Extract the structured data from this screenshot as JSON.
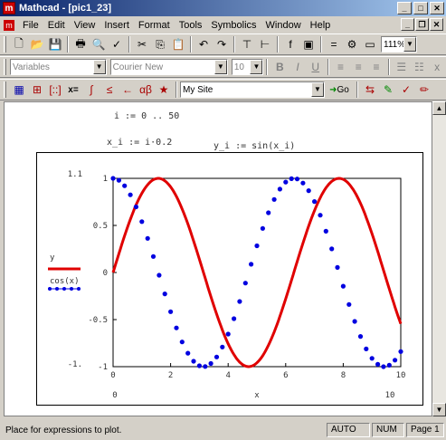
{
  "window": {
    "app_name": "Mathcad",
    "doc_title": "Mathcad - [pic1_23]"
  },
  "menu": [
    "File",
    "Edit",
    "View",
    "Insert",
    "Format",
    "Tools",
    "Symbolics",
    "Window",
    "Help"
  ],
  "toolbar": {
    "zoom": "111%"
  },
  "format_bar": {
    "style": "Variables",
    "font": "Courier New",
    "size": "10"
  },
  "math_bar": {
    "resource": "My Site",
    "go_label": "Go"
  },
  "worksheet": {
    "expr_range": "i := 0 .. 50",
    "expr_x": "x_i := i·0.2",
    "expr_y": "y_i := sin(x_i)"
  },
  "chart_data": {
    "type": "line",
    "x": [
      0,
      0.5,
      1,
      1.5,
      2,
      2.5,
      3,
      3.5,
      4,
      4.5,
      5,
      5.5,
      6,
      6.5,
      7,
      7.5,
      8,
      8.5,
      9,
      9.5,
      10
    ],
    "series": [
      {
        "name": "y",
        "style": "line",
        "color": "#e00000"
      },
      {
        "name": "cos(x)",
        "style": "dots",
        "color": "#0000e0"
      }
    ],
    "xlim": [
      0,
      10
    ],
    "ylim": [
      -1,
      1
    ],
    "xlabel": "x",
    "x_ticks": [
      "0",
      "2",
      "4",
      "6",
      "8",
      "10"
    ],
    "y_ticks": [
      "1",
      "0.5",
      "0",
      "-0.5",
      "-1"
    ],
    "x_min_label": "0",
    "x_max_label": "10",
    "y_max_label": "1.1",
    "y_min_label": "-1."
  },
  "status": {
    "message": "Place for expressions to plot.",
    "mode": "AUTO",
    "num": "NUM",
    "page": "Page 1"
  },
  "colors": {
    "title_start": "#0a246a",
    "title_end": "#a6caf0",
    "series_y": "#e00000",
    "series_cos": "#0000e0"
  }
}
